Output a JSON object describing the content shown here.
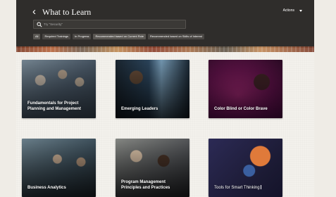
{
  "header": {
    "back_icon": "chevron-left-icon",
    "title": "What to Learn",
    "actions_label": "Actions"
  },
  "search": {
    "placeholder": "Try \"Security\"",
    "value": ""
  },
  "filters": [
    {
      "label": "All"
    },
    {
      "label": "Required Trainings"
    },
    {
      "label": "In Progress"
    },
    {
      "label": "Recommended based on Current Role"
    },
    {
      "label": "Recommended based on Skills of Interest"
    }
  ],
  "cards": [
    {
      "title": "Fundamentals for Project Planning and Management"
    },
    {
      "title": "Emerging Leaders"
    },
    {
      "title": "Color Blind or Color Brave"
    },
    {
      "title": "Business Analytics"
    },
    {
      "title": "Program Management Principles and Practices"
    },
    {
      "title": "Tools for Smart Thinking"
    }
  ],
  "colors": {
    "header_bg": "#2f2d2b",
    "page_bg": "#f3f1ec"
  }
}
